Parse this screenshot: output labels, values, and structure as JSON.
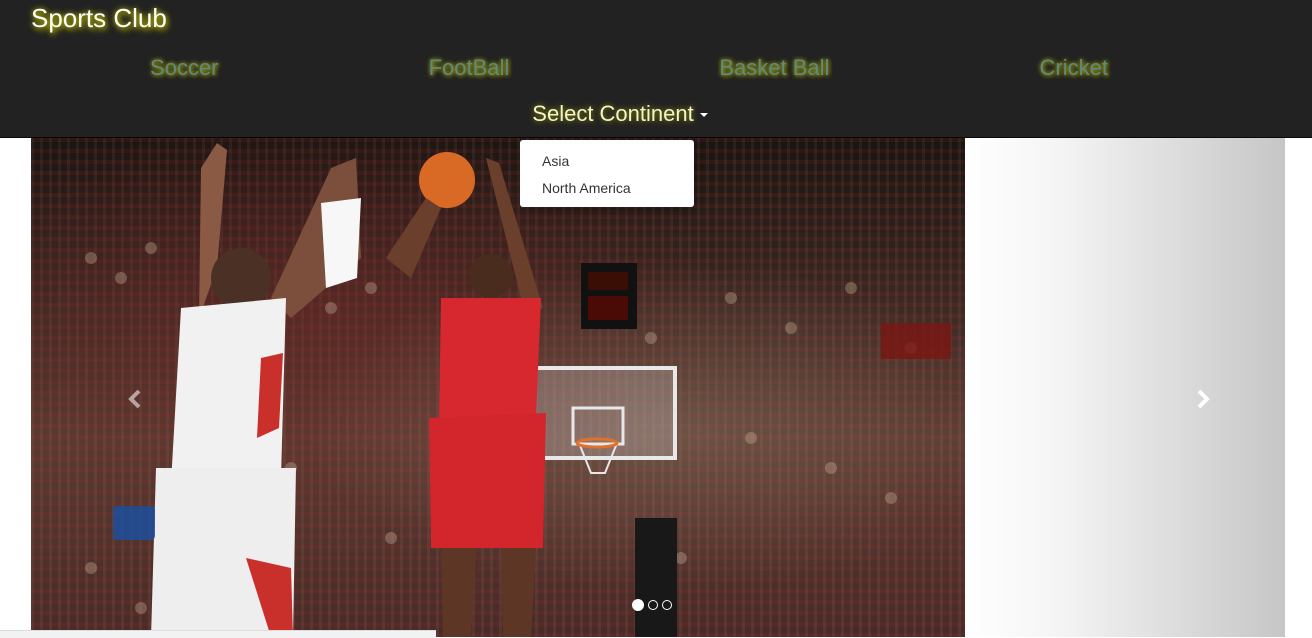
{
  "navbar": {
    "brand": "Sports Club",
    "links": [
      {
        "label": "Soccer"
      },
      {
        "label": "FootBall"
      },
      {
        "label": "Basket Ball"
      },
      {
        "label": "Cricket"
      }
    ],
    "continent_label": "Select Continent"
  },
  "dropdown": {
    "items": [
      {
        "label": "Asia"
      },
      {
        "label": "North America"
      }
    ]
  },
  "carousel": {
    "slide_count": 3,
    "active_index": 0,
    "prev_icon": "chevron-left-icon",
    "next_icon": "chevron-right-icon"
  },
  "colors": {
    "navbar_bg": "#222222",
    "brand_glow": "#c8c800",
    "link_color": "#5e8a80"
  }
}
